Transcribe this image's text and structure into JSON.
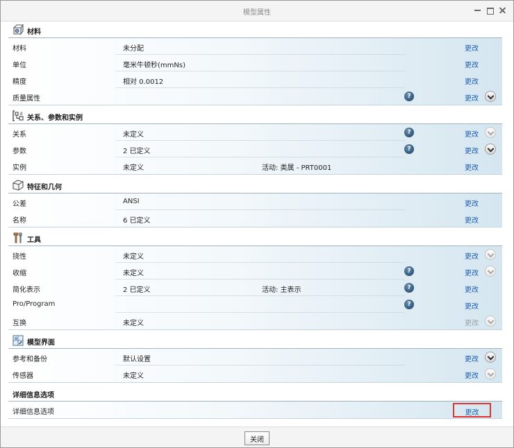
{
  "window": {
    "title": "模型属性"
  },
  "edit_label": "更改",
  "help_glyph": "?",
  "sections": [
    {
      "title": "材料",
      "icon": "material-icon",
      "rows": [
        {
          "label": "材料",
          "value": "未分配",
          "extra": "",
          "help": false,
          "edit_disabled": false,
          "chevron": "none"
        },
        {
          "label": "单位",
          "value": "毫米牛顿秒(mmNs)",
          "extra": "",
          "help": false,
          "edit_disabled": false,
          "chevron": "none"
        },
        {
          "label": "精度",
          "value": "相对 0.0012",
          "extra": "",
          "help": false,
          "edit_disabled": false,
          "chevron": "none"
        },
        {
          "label": "质量属性",
          "value": "",
          "extra": "",
          "help": true,
          "edit_disabled": false,
          "chevron": "dark"
        }
      ]
    },
    {
      "title": "关系、参数和实例",
      "icon": "relations-icon",
      "rows": [
        {
          "label": "关系",
          "value": "未定义",
          "extra": "",
          "help": true,
          "edit_disabled": false,
          "chevron": "dim"
        },
        {
          "label": "参数",
          "value": "2 已定义",
          "extra": "",
          "help": true,
          "edit_disabled": false,
          "chevron": "dark"
        },
        {
          "label": "实例",
          "value": "未定义",
          "extra": "活动: 类属 - PRT0001",
          "help": false,
          "edit_disabled": false,
          "chevron": "none"
        }
      ]
    },
    {
      "title": "特征和几何",
      "icon": "features-icon",
      "rows": [
        {
          "label": "公差",
          "value": "ANSI",
          "extra": "",
          "help": false,
          "edit_disabled": false,
          "chevron": "none"
        },
        {
          "label": "名称",
          "value": "6 已定义",
          "extra": "",
          "help": false,
          "edit_disabled": false,
          "chevron": "none"
        }
      ]
    },
    {
      "title": "工具",
      "icon": "tools-icon",
      "rows": [
        {
          "label": "挠性",
          "value": "未定义",
          "extra": "",
          "help": false,
          "edit_disabled": false,
          "chevron": "dim"
        },
        {
          "label": "收缩",
          "value": "未定义",
          "extra": "",
          "help": true,
          "edit_disabled": false,
          "chevron": "dim"
        },
        {
          "label": "简化表示",
          "value": "2 已定义",
          "extra": "活动: 主表示",
          "help": true,
          "edit_disabled": false,
          "chevron": "none"
        },
        {
          "label": "Pro/Program",
          "value": "",
          "extra": "",
          "help": true,
          "edit_disabled": false,
          "chevron": "none"
        },
        {
          "label": "互换",
          "value": "未定义",
          "extra": "",
          "help": false,
          "edit_disabled": true,
          "chevron": "dim"
        }
      ]
    },
    {
      "title": "模型界面",
      "icon": "model-interface-icon",
      "rows": [
        {
          "label": "参考和备份",
          "value": "默认设置",
          "extra": "",
          "help": false,
          "edit_disabled": false,
          "chevron": "dark"
        },
        {
          "label": "传感器",
          "value": "未定义",
          "extra": "",
          "help": false,
          "edit_disabled": false,
          "chevron": "dim"
        }
      ]
    },
    {
      "title": "详细信息选项",
      "icon": "",
      "rows": [
        {
          "label": "详细信息选项",
          "value": "",
          "extra": "",
          "help": false,
          "edit_disabled": false,
          "chevron": "none",
          "highlight": true
        }
      ]
    }
  ],
  "footer": {
    "close_label": "关闭"
  },
  "colors": {
    "link": "#1f5fb0",
    "highlight_border": "#e0322f",
    "row_gradient_end": "#d5e6f0"
  }
}
